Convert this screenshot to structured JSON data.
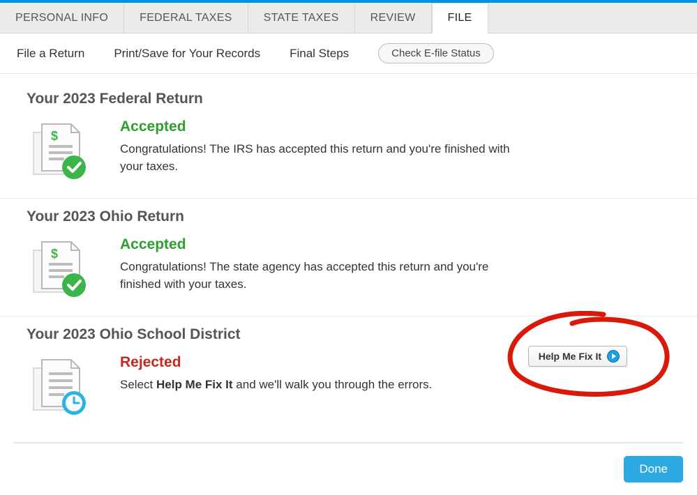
{
  "primaryTabs": {
    "personal": "PERSONAL INFO",
    "federal": "FEDERAL TAXES",
    "state": "STATE TAXES",
    "review": "REVIEW",
    "file": "FILE"
  },
  "secondaryNav": {
    "fileReturn": "File a Return",
    "printSave": "Print/Save for Your Records",
    "finalSteps": "Final Steps",
    "checkStatus": "Check E-file Status"
  },
  "returns": {
    "federal": {
      "title": "Your 2023 Federal Return",
      "status": "Accepted",
      "desc": "Congratulations! The IRS has accepted this return and you're finished with your taxes."
    },
    "ohio": {
      "title": "Your 2023 Ohio Return",
      "status": "Accepted",
      "desc": "Congratulations! The state agency has accepted this return and you're finished with your taxes."
    },
    "ohioSD": {
      "title": "Your 2023 Ohio School District",
      "status": "Rejected",
      "descPrefix": "Select ",
      "descBold": "Help Me Fix It",
      "descSuffix": " and we'll walk you through the errors."
    }
  },
  "buttons": {
    "helpFix": "Help Me Fix It",
    "done": "Done"
  }
}
